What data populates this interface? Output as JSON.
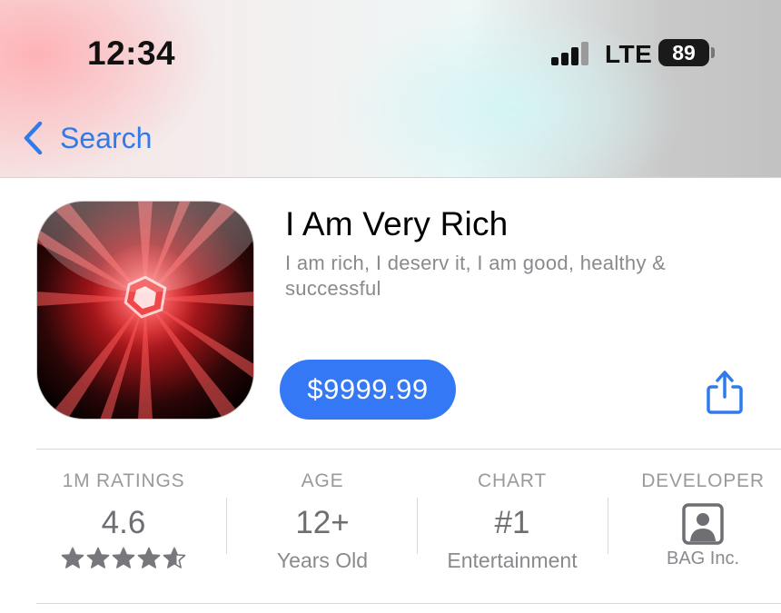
{
  "status_bar": {
    "time": "12:34",
    "network": "LTE",
    "battery": "89"
  },
  "nav": {
    "back_label": "Search",
    "back_icon": "chevron-left-icon",
    "accent_color": "#2f7bea"
  },
  "app": {
    "title": "I Am Very Rich",
    "subtitle": "I am rich, I deserv it, I am good, healthy & successful",
    "price": "$9999.99",
    "price_button_color": "#3478f6",
    "share_icon": "share-icon"
  },
  "stats": [
    {
      "heading": "1M RATINGS",
      "value": "4.6",
      "rating": 4.6,
      "max_rating": 5
    },
    {
      "heading": "AGE",
      "value": "12+",
      "sub": "Years Old"
    },
    {
      "heading": "CHART",
      "value": "#1",
      "sub": "Entertainment"
    },
    {
      "heading": "DEVELOPER",
      "icon": "person-icon",
      "sub": "BAG Inc."
    }
  ]
}
